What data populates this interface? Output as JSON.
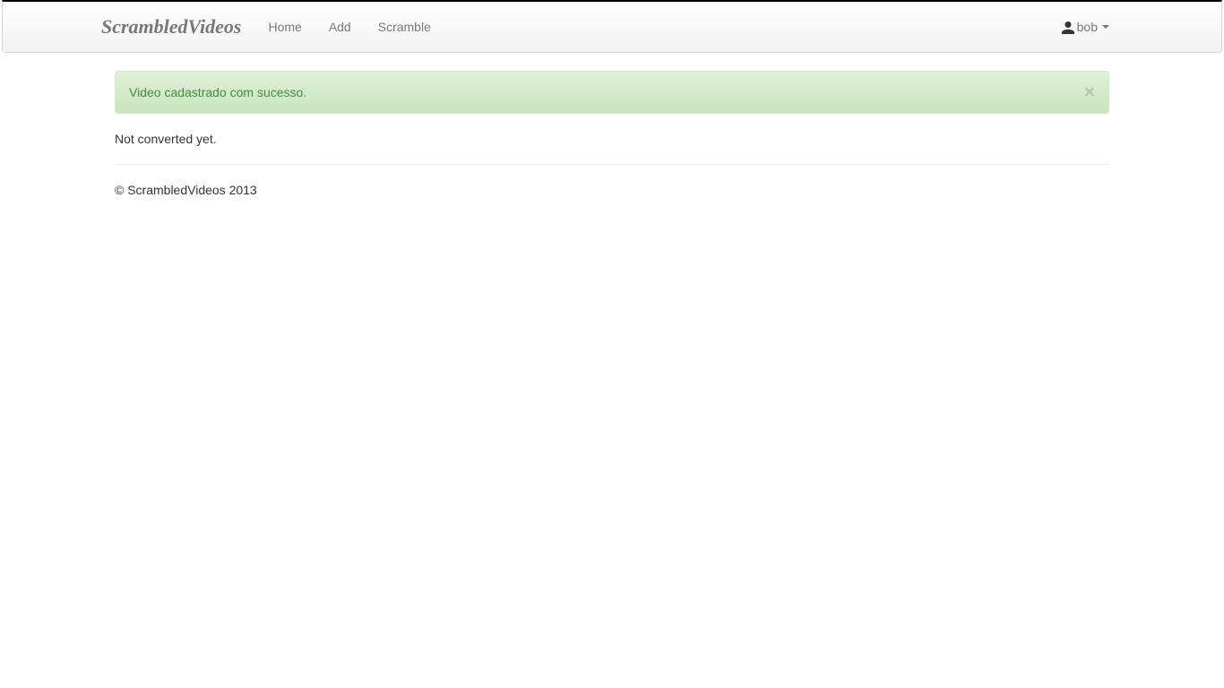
{
  "navbar": {
    "brand": "ScrambledVideos",
    "links": [
      {
        "label": "Home"
      },
      {
        "label": "Add"
      },
      {
        "label": "Scramble"
      }
    ],
    "user": {
      "name": "bob"
    }
  },
  "alert": {
    "message": "Video cadastrado com sucesso.",
    "close": "×"
  },
  "main": {
    "status": "Not converted yet."
  },
  "footer": {
    "copyright": "© ScrambledVideos 2013"
  }
}
